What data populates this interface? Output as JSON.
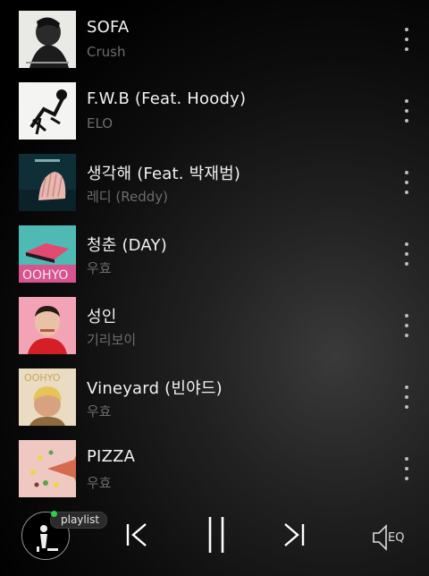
{
  "tracks": [
    {
      "title": "SOFA",
      "artist": "Crush",
      "art_icon": "sofa-cover"
    },
    {
      "title": "F.W.B (Feat. Hoody)",
      "artist": "ELO",
      "art_icon": "fwb-cover"
    },
    {
      "title": "생각해 (Feat. 박재범)",
      "artist": "레디 (Reddy)",
      "art_icon": "think-cover"
    },
    {
      "title": "청춘 (DAY)",
      "artist": "우효",
      "art_icon": "day-cover"
    },
    {
      "title": "성인",
      "artist": "기리보이",
      "art_icon": "adult-cover"
    },
    {
      "title": "Vineyard (빈야드)",
      "artist": "우효",
      "art_icon": "vineyard-cover"
    },
    {
      "title": "PIZZA",
      "artist": "우효",
      "art_icon": "pizza-cover"
    }
  ],
  "player": {
    "playlist_label": "playlist",
    "eq_label": "EQ",
    "state": "playing",
    "status_dot_color": "#2ecf4a",
    "controls": [
      "skip-previous-icon",
      "pause-icon",
      "skip-next-icon",
      "equalizer-icon"
    ]
  },
  "colors": {
    "title": "#f2f2f2",
    "artist": "#6c6c6c",
    "background": "#000000"
  }
}
